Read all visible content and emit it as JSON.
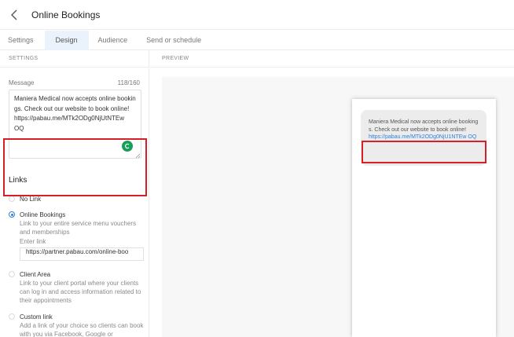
{
  "header": {
    "back_icon": "chevron-left-icon",
    "title": "Online Bookings"
  },
  "tabs": [
    {
      "label": "Settings",
      "active": false
    },
    {
      "label": "Design",
      "active": true
    },
    {
      "label": "Audience",
      "active": false
    },
    {
      "label": "Send or schedule",
      "active": false
    }
  ],
  "sections": {
    "settings": "SETTINGS",
    "preview": "PREVIEW"
  },
  "message": {
    "label": "Message",
    "count": "118/160",
    "text": "Maniera Medical now accepts online bookings. Check out our website to book online!\nhttps://pabau.me/MTk2ODg0NjUtNTEw\nOQ",
    "grammar_icon": "grammar-check-icon"
  },
  "links": {
    "title": "Links",
    "options": [
      {
        "label": "No Link",
        "selected": false,
        "description": ""
      },
      {
        "label": "Online Bookings",
        "selected": true,
        "description": "Link to your entire service menu vouchers and memberships",
        "enter_link_label": "Enter link",
        "link_value": "https://partner.pabau.com/online-boo"
      },
      {
        "label": "Client Area",
        "selected": false,
        "description": "Link to your client portal where your clients can log in and access information related to their appointments"
      },
      {
        "label": "Custom link",
        "selected": false,
        "description": "Add a link of your choice so clients can book with you via Facebook, Google or"
      }
    ]
  },
  "preview": {
    "message": "Maniera Medical now accepts online bookings. Check out our website to book online!",
    "link": "https://pabau.me/MTk2ODg0NjU1NTEw OQ"
  },
  "colors": {
    "accent": "#2f7fd8",
    "highlight": "#d61f26",
    "tab_active_bg": "#eaf3fb"
  }
}
